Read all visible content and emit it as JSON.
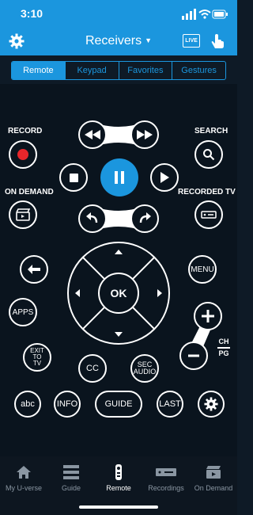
{
  "status_bar": {
    "time": "3:10"
  },
  "header": {
    "title": "Receivers",
    "live_label": "LIVE"
  },
  "tabs": [
    {
      "label": "Remote",
      "active": true
    },
    {
      "label": "Keypad",
      "active": false
    },
    {
      "label": "Favorites",
      "active": false
    },
    {
      "label": "Gestures",
      "active": false
    }
  ],
  "remote": {
    "record_label": "RECORD",
    "search_label": "SEARCH",
    "on_demand_label": "ON DEMAND",
    "recorded_tv_label": "RECORDED TV",
    "ok_label": "OK",
    "menu_label": "MENU",
    "apps_label": "APPS",
    "exit_label": "EXIT TO TV",
    "cc_label": "CC",
    "sec_audio_label": "SEC AUDIO",
    "ch_label": "CH",
    "pg_label": "PG",
    "abc_label": "abc",
    "info_label": "INFO",
    "guide_label": "GUIDE",
    "last_label": "LAST"
  },
  "bottom_nav": [
    {
      "label": "My U-verse",
      "icon": "home-icon",
      "active": false
    },
    {
      "label": "Guide",
      "icon": "guide-icon",
      "active": false
    },
    {
      "label": "Remote",
      "icon": "remote-icon",
      "active": true
    },
    {
      "label": "Recordings",
      "icon": "recordings-icon",
      "active": false
    },
    {
      "label": "On Demand",
      "icon": "on-demand-icon",
      "active": false
    }
  ],
  "colors": {
    "accent": "#1b96de",
    "record": "#e8262b"
  }
}
